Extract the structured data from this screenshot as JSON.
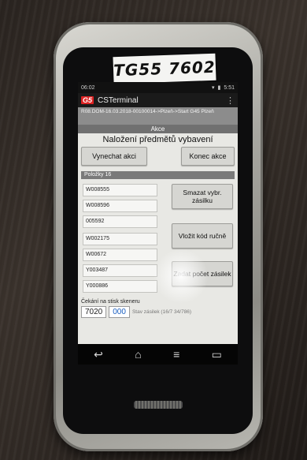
{
  "sticker": {
    "text": "TG55 7602"
  },
  "statusbar": {
    "left": "06:02",
    "right": "5:51"
  },
  "appbar": {
    "logo": "G5",
    "title": "CSTerminal",
    "menu": "⋮"
  },
  "path": "R08.DOM-16.03.2018-00100014->Plzeň->Start G45 Plzeň",
  "section": {
    "header": "Akce",
    "title": "Naložení předmětů vybavení"
  },
  "actions": {
    "skip": "Vynechat akci",
    "end": "Konec akce"
  },
  "items_header": "Položky 16",
  "items": [
    "W008555",
    "W008596",
    "005592",
    "W002175",
    "W00672",
    "Y003487",
    "Y000886"
  ],
  "side_buttons": {
    "delete": "Smazat vybr. zásilku",
    "manual": "Vložit kód ručně",
    "count": "Zadat počet zásilek"
  },
  "wait_text": "Čekání na stisk skeneru",
  "bottom": {
    "num1": "7020",
    "num2": "000",
    "state": "Stav zásilek (16/7 34/786)"
  },
  "nav": {
    "back": "↩",
    "home": "⌂",
    "menu": "≡",
    "recent": "▭"
  }
}
